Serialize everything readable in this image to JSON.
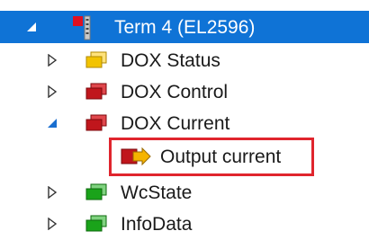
{
  "tree": {
    "root": {
      "label": "Term 4 (EL2596)",
      "icon": "terminal-icon",
      "expanded": true,
      "selected": true
    },
    "children": [
      {
        "label": "DOX Status",
        "icon": "input-variable-folder-icon",
        "color": "#f2c300",
        "expanded": false
      },
      {
        "label": "DOX Control",
        "icon": "output-variable-folder-icon",
        "color": "#c0161c",
        "expanded": false
      },
      {
        "label": "DOX Current",
        "icon": "output-variable-folder-icon",
        "color": "#c0161c",
        "expanded": true,
        "children": [
          {
            "label": "Output current",
            "icon": "output-variable-arrow-icon",
            "highlighted": true
          }
        ]
      },
      {
        "label": "WcState",
        "icon": "status-variable-folder-icon",
        "color": "#1aa31a",
        "expanded": false
      },
      {
        "label": "InfoData",
        "icon": "status-variable-folder-icon",
        "color": "#1aa31a",
        "expanded": false
      }
    ]
  },
  "colors": {
    "selection": "#0f73d6",
    "highlight_border": "#e0252d"
  }
}
